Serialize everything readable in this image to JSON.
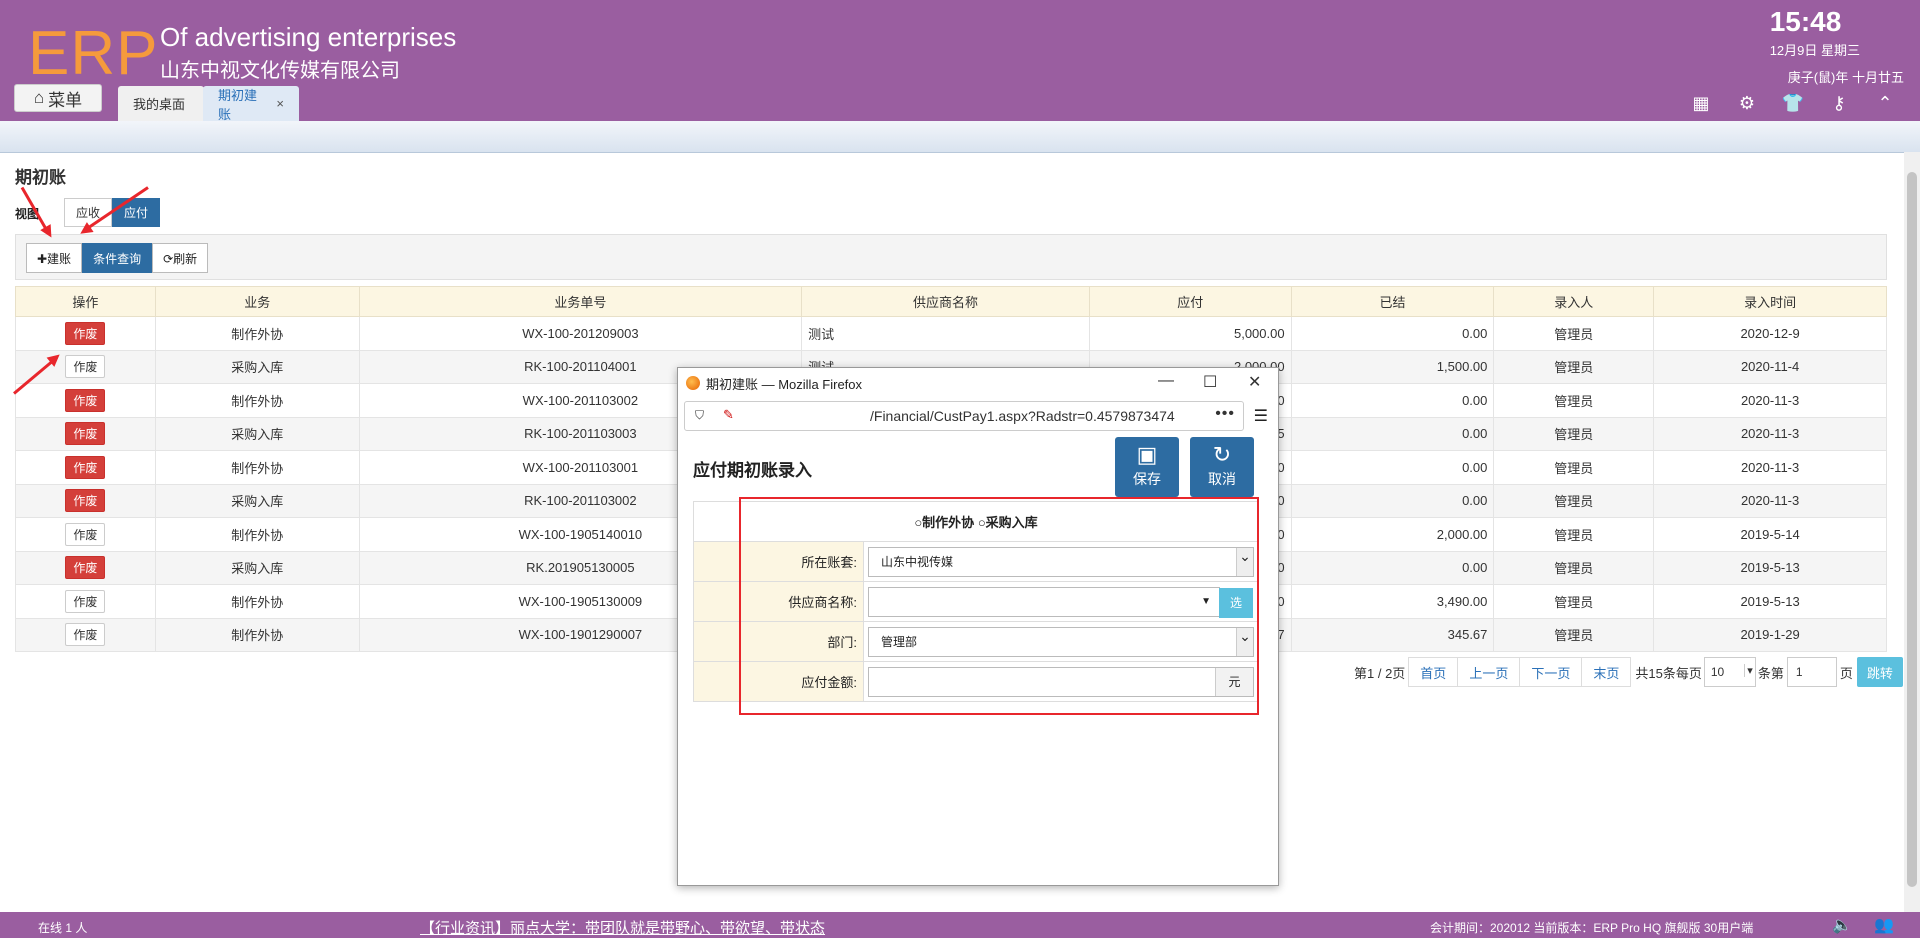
{
  "header": {
    "logo": "ERP",
    "company_en": "Of advertising enterprises",
    "company_cn": "山东中视文化传媒有限公司",
    "time": "15:48",
    "date": "12月9日 星期三",
    "lunar": "庚子(鼠)年 十月廿五",
    "menu_label": "菜单",
    "tabs": [
      {
        "label": "我的桌面"
      },
      {
        "label": "期初建账",
        "close": "×"
      }
    ]
  },
  "page": {
    "title": "期初账",
    "view_label": "视图",
    "views": [
      "应收",
      "应付"
    ],
    "active_view": "应付",
    "toolbar": {
      "new": "✚建账",
      "query": "条件查询",
      "refresh": "⟳刷新"
    }
  },
  "table": {
    "headers": [
      "操作",
      "业务",
      "业务单号",
      "供应商名称",
      "应付",
      "已结",
      "录入人",
      "录入时间"
    ],
    "rows": [
      {
        "op": "作废",
        "red": true,
        "biz": "制作外协",
        "no": "WX-100-201209003",
        "sup": "测试",
        "pay": "5,000.00",
        "paid": "0.00",
        "user": "管理员",
        "date": "2020-12-9"
      },
      {
        "op": "作废",
        "red": false,
        "biz": "采购入库",
        "no": "RK-100-201104001",
        "sup": "测试",
        "pay": "2,000.00",
        "paid": "1,500.00",
        "user": "管理员",
        "date": "2020-11-4"
      },
      {
        "op": "作废",
        "red": true,
        "biz": "制作外协",
        "no": "WX-100-201103002",
        "sup": "",
        "pay": "0",
        "paid": "0.00",
        "user": "管理员",
        "date": "2020-11-3"
      },
      {
        "op": "作废",
        "red": true,
        "biz": "采购入库",
        "no": "RK-100-201103003",
        "sup": "",
        "pay": "5",
        "paid": "0.00",
        "user": "管理员",
        "date": "2020-11-3"
      },
      {
        "op": "作废",
        "red": true,
        "biz": "制作外协",
        "no": "WX-100-201103001",
        "sup": "",
        "pay": "0",
        "paid": "0.00",
        "user": "管理员",
        "date": "2020-11-3"
      },
      {
        "op": "作废",
        "red": true,
        "biz": "采购入库",
        "no": "RK-100-201103002",
        "sup": "",
        "pay": "0",
        "paid": "0.00",
        "user": "管理员",
        "date": "2020-11-3"
      },
      {
        "op": "作废",
        "red": false,
        "biz": "制作外协",
        "no": "WX-100-1905140010",
        "sup": "",
        "pay": "0",
        "paid": "2,000.00",
        "user": "管理员",
        "date": "2019-5-14"
      },
      {
        "op": "作废",
        "red": true,
        "biz": "采购入库",
        "no": "RK.201905130005",
        "sup": "",
        "pay": "0",
        "paid": "0.00",
        "user": "管理员",
        "date": "2019-5-13"
      },
      {
        "op": "作废",
        "red": false,
        "biz": "制作外协",
        "no": "WX-100-1905130009",
        "sup": "",
        "pay": "0",
        "paid": "3,490.00",
        "user": "管理员",
        "date": "2019-5-13"
      },
      {
        "op": "作废",
        "red": false,
        "biz": "制作外协",
        "no": "WX-100-1901290007",
        "sup": "",
        "pay": "7",
        "paid": "345.67",
        "user": "管理员",
        "date": "2019-1-29"
      }
    ]
  },
  "pager": {
    "info": "第1 / 2页",
    "first": "首页",
    "prev": "上一页",
    "next": "下一页",
    "last": "末页",
    "total": "共15条每页",
    "size": "10",
    "goto_pre": "条第",
    "page": "1",
    "goto_post": "页",
    "jump": "跳转"
  },
  "footer": {
    "online": "在线  1  人",
    "news": "【行业资讯】丽点大学：带团队就是带野心、带欲望、带状态",
    "version": "会计期间：202012 当前版本：ERP Pro HQ 旗舰版 30用户端"
  },
  "popup": {
    "window_title": "期初建账 — Mozilla Firefox",
    "url": "/Financial/CustPay1.aspx?Radstr=0.4579873474",
    "form_title": "应付期初账录入",
    "save": "保存",
    "cancel": "取消",
    "radio1": "制作外协",
    "radio2": "采购入库",
    "fields": {
      "ledger_label": "所在账套:",
      "ledger_value": "山东中视传媒",
      "supplier_label": "供应商名称:",
      "supplier_pick": "选",
      "dept_label": "部门:",
      "dept_value": "管理部",
      "amount_label": "应付金额:",
      "amount_unit": "元"
    }
  }
}
